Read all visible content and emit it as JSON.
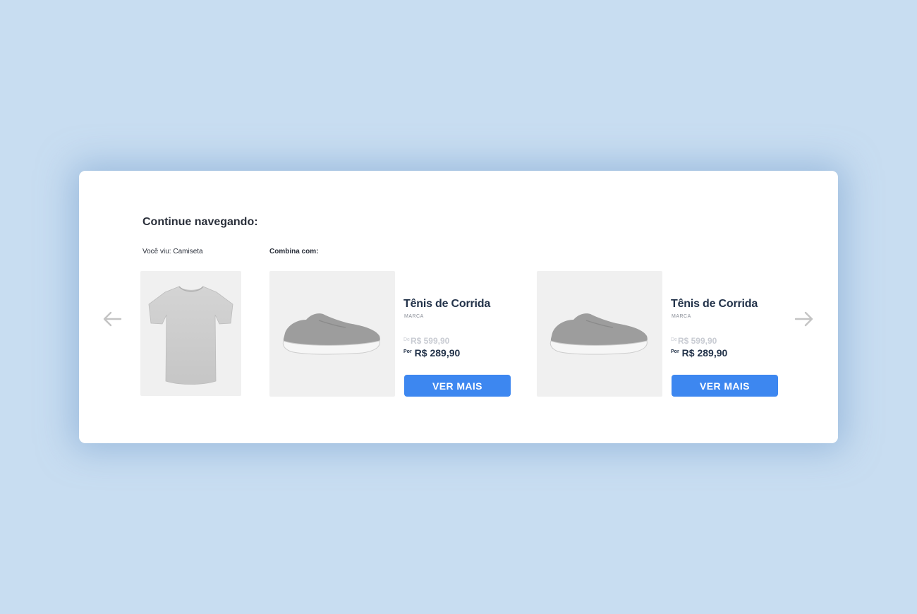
{
  "section": {
    "title": "Continue navegando:",
    "viewed_label": "Você viu: Camiseta",
    "combo_label": "Combina com:"
  },
  "products": [
    {
      "name": "Tênis de Corrida",
      "brand": "MARCA",
      "old_prefix": "De",
      "old_price": "R$ 599,90",
      "new_prefix": "Por",
      "new_price": "R$ 289,90",
      "button": "VER MAIS"
    },
    {
      "name": "Tênis de Corrida",
      "brand": "MARCA",
      "old_prefix": "De",
      "old_price": "R$ 599,90",
      "new_prefix": "Por",
      "new_price": "R$ 289,90",
      "button": "VER MAIS"
    }
  ],
  "icons": {
    "prev": "arrow-left-icon",
    "next": "arrow-right-icon"
  },
  "colors": {
    "background": "#c8ddf1",
    "button": "#3d87f0",
    "text_dark": "#23334a",
    "old_price": "#c9ccd3"
  }
}
